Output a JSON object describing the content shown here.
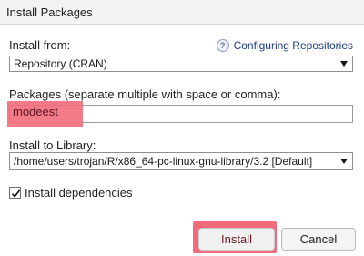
{
  "window": {
    "title": "Install Packages"
  },
  "install_from": {
    "label": "Install from:",
    "help_link": "Configuring Repositories",
    "selected": "Repository (CRAN)"
  },
  "packages": {
    "label": "Packages (separate multiple with space or comma):",
    "value": "modeest"
  },
  "library": {
    "label": "Install to Library:",
    "selected": "/home/users/trojan/R/x86_64-pc-linux-gnu-library/3.2 [Default]"
  },
  "dependencies": {
    "label": "Install dependencies",
    "checked": true
  },
  "buttons": {
    "install": "Install",
    "cancel": "Cancel"
  },
  "colors": {
    "highlight": "#f26b7a",
    "link": "#1a3b8c"
  }
}
